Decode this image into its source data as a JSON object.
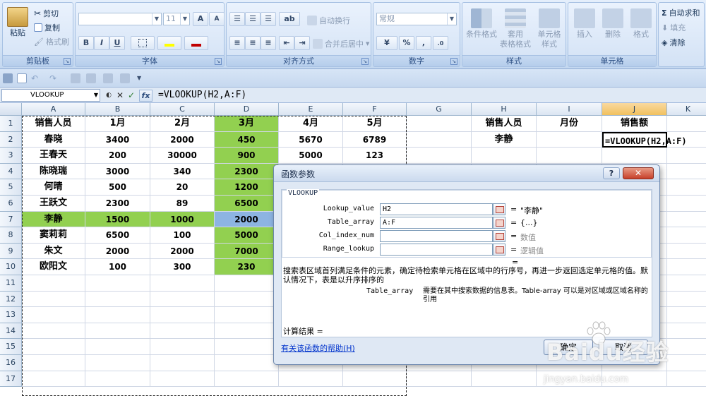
{
  "ribbon": {
    "clipboard": {
      "paste": "粘贴",
      "cut": "剪切",
      "copy": "复制",
      "format_painter": "格式刷",
      "caption": "剪贴板"
    },
    "font": {
      "font_size": "11",
      "bold": "B",
      "italic": "I",
      "underline": "U",
      "grow": "A",
      "shrink": "A",
      "caption": "字体"
    },
    "alignment": {
      "wrap": "自动换行",
      "merge": "合并后居中",
      "caption": "对齐方式"
    },
    "number": {
      "format": "常规",
      "percent": "%",
      "comma": ",",
      "caption": "数字"
    },
    "styles": {
      "conditional": "条件格式",
      "table_line1": "套用",
      "table_line2": "表格格式",
      "cell_line1": "单元格",
      "cell_line2": "样式",
      "caption": "样式"
    },
    "cells": {
      "insert": "插入",
      "delete": "删除",
      "format": "格式",
      "caption": "单元格"
    },
    "editing": {
      "autosum": "自动求和",
      "fill": "填充",
      "clear": "清除"
    }
  },
  "formula_bar": {
    "name_box": "VLOOKUP",
    "cancel": "✕",
    "enter": "✓",
    "fx": "fx",
    "formula": "=VLOOKUP(H2,A:F)"
  },
  "sheet": {
    "columns": [
      "A",
      "B",
      "C",
      "D",
      "E",
      "F",
      "G",
      "H",
      "I",
      "J",
      "K"
    ],
    "rows": [
      "1",
      "2",
      "3",
      "4",
      "5",
      "6",
      "7",
      "8",
      "9",
      "10",
      "11",
      "12",
      "13",
      "14",
      "15",
      "16",
      "17"
    ],
    "header_row": [
      "销售人员",
      "1月",
      "2月",
      "3月",
      "4月",
      "5月"
    ],
    "data": [
      [
        "春晓",
        "3400",
        "2000",
        "450",
        "5670",
        "6789"
      ],
      [
        "王春天",
        "200",
        "30000",
        "900",
        "5000",
        "123"
      ],
      [
        "陈晓瑞",
        "3000",
        "340",
        "2300",
        "",
        ""
      ],
      [
        "何晴",
        "500",
        "20",
        "1200",
        "",
        ""
      ],
      [
        "王跃文",
        "2300",
        "89",
        "6500",
        "",
        ""
      ],
      [
        "李静",
        "1500",
        "1000",
        "2000",
        "",
        ""
      ],
      [
        "窦莉莉",
        "6500",
        "100",
        "5000",
        "",
        ""
      ],
      [
        "朱文",
        "2000",
        "2000",
        "7000",
        "",
        ""
      ],
      [
        "欧阳文",
        "100",
        "300",
        "230",
        "",
        ""
      ]
    ],
    "lookup_headers": [
      "销售人员",
      "月份",
      "销售额"
    ],
    "lookup_name": "李静",
    "lookup_formula": "=VLOOKUP(H2,A:F)"
  },
  "dialog": {
    "title": "函数参数",
    "help_button": "?",
    "close_button": "✕",
    "function_name": "VLOOKUP",
    "args": [
      {
        "label": "Lookup_value",
        "value": "H2",
        "result": "\"李静\""
      },
      {
        "label": "Table_array",
        "value": "A:F",
        "result": "{...}"
      },
      {
        "label": "Col_index_num",
        "value": "",
        "result": "数值"
      },
      {
        "label": "Range_lookup",
        "value": "",
        "result": "逻辑值"
      }
    ],
    "mid_eq": "=",
    "description": "搜索表区域首列满足条件的元素，确定待检索单元格在区域中的行序号，再进一步返回选定单元格的值。默认情况下，表是以升序排序的",
    "arg_name": "Table_array",
    "arg_desc": "需要在其中搜索数据的信息表。Table-array 可以是对区域或区域名称的引用",
    "result_label": "计算结果 =",
    "help_link": "有关该函数的帮助(H)",
    "ok": "确定",
    "cancel": "取消"
  },
  "watermark": {
    "text": "Baidu经验",
    "url": "jingyan.baidu.com"
  },
  "colors": {
    "green": "#92d050",
    "blue": "#8db4e2",
    "selected_header": "#f1c15f"
  }
}
